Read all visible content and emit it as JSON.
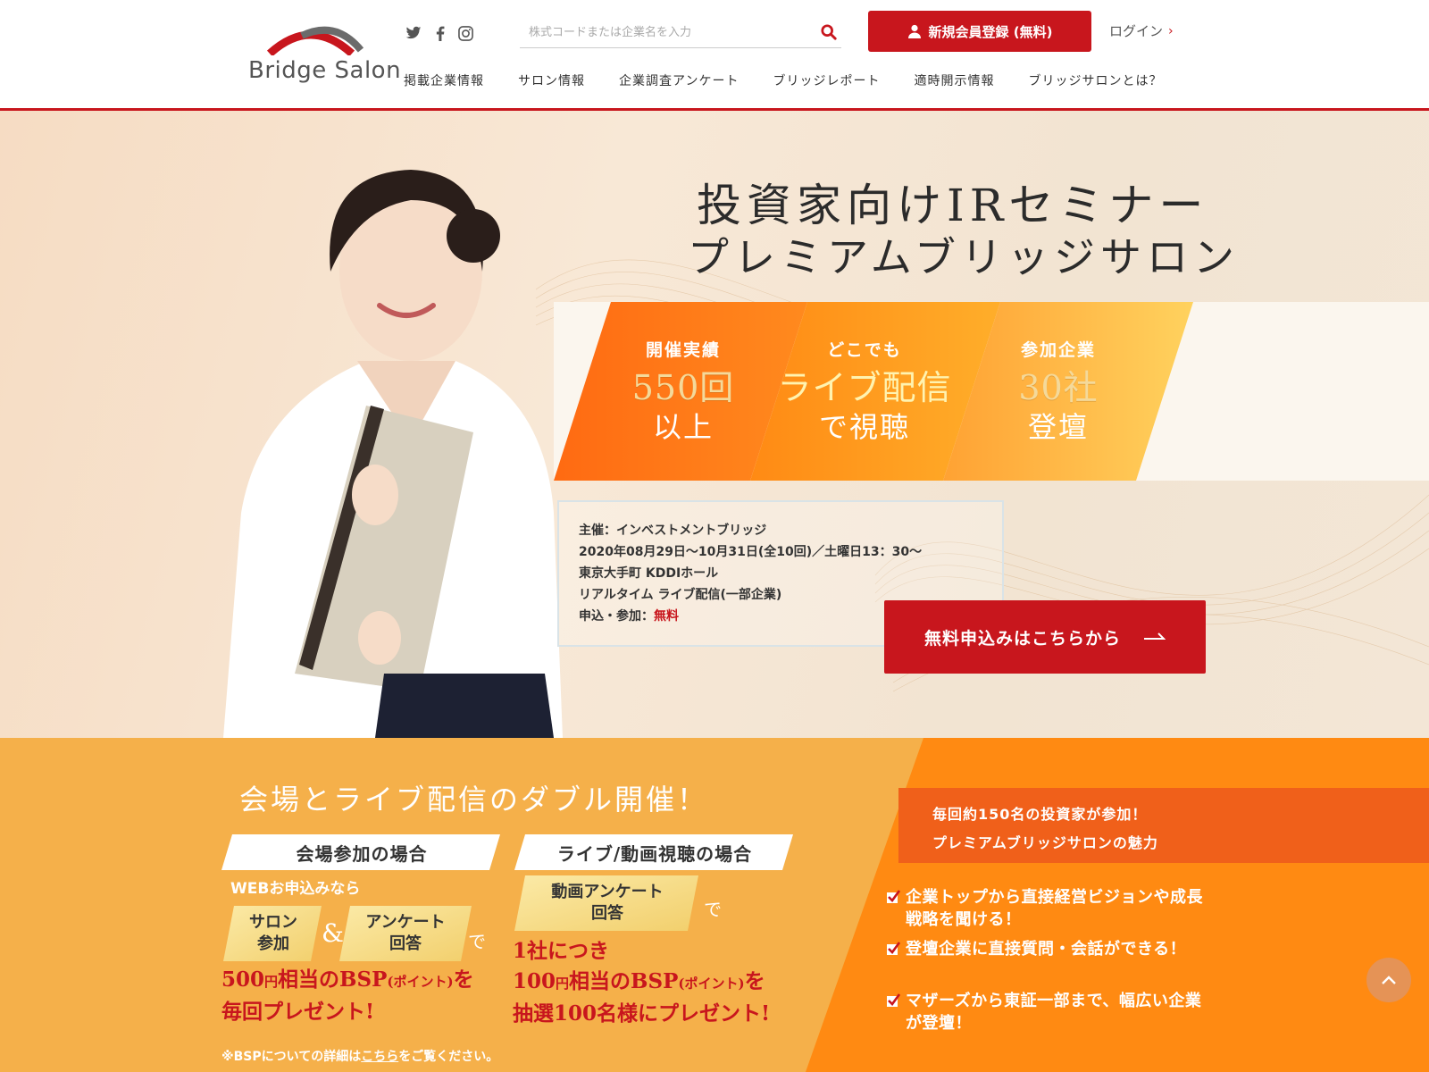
{
  "header": {
    "logo_text": "Bridge Salon",
    "social": [
      {
        "name": "twitter-icon"
      },
      {
        "name": "facebook-icon"
      },
      {
        "name": "instagram-icon"
      }
    ],
    "search": {
      "placeholder": "株式コードまたは企業名を入力"
    },
    "register_label": "新規会員登録 (無料)",
    "login_label": "ログイン",
    "nav": [
      "掲載企業情報",
      "サロン情報",
      "企業調査アンケート",
      "ブリッジレポート",
      "適時開示情報",
      "ブリッジサロンとは？"
    ]
  },
  "hero": {
    "title_line1": "投資家向けIRセミナー",
    "title_line2": "プレミアムブリッジサロン",
    "band": [
      {
        "small": "開催実績",
        "big": "550回",
        "big2": "以上"
      },
      {
        "small": "どこでも",
        "big": "ライブ配信",
        "big2": "で視聴"
      },
      {
        "small": "参加企業",
        "big": "30社",
        "big2": "登壇"
      }
    ],
    "info": {
      "organizer": "主催：インベストメントブリッジ",
      "dates": "2020年08月29日〜10月31日(全10回)／土曜日13：30〜",
      "venue": "東京大手町 KDDIホール",
      "live": "リアルタイム ライブ配信(一部企業)",
      "fee_label": "申込・参加：",
      "fee_value": "無料"
    },
    "cta_label": "無料申込みはこちらから"
  },
  "bottom": {
    "title": "会場とライブ配信のダブル開催！",
    "venue_tab": "会場参加の場合",
    "live_tab": "ライブ/動画視聴の場合",
    "web_note": "WEBお申込みなら",
    "tag_salon_1": "サロン",
    "tag_salon_2": "参加",
    "amp": "&",
    "tag_survey_1": "アンケート",
    "tag_survey_2": "回答",
    "de": "で",
    "tag_video_1": "動画アンケート",
    "tag_video_2": "回答",
    "venue_copy_1a": "500",
    "venue_copy_1b": "円",
    "venue_copy_1c": "相当のBSP",
    "venue_copy_1d": "(ポイント)",
    "venue_copy_1e": "を",
    "venue_copy_2": "毎回プレゼント!",
    "live_copy_1": "1社につき",
    "live_copy_2a": "100",
    "live_copy_2b": "円",
    "live_copy_2c": "相当のBSP",
    "live_copy_2d": "(ポイント)",
    "live_copy_2e": "を",
    "live_copy_3": "抽選100名様にプレゼント!",
    "bsp_note_a": "※BSPについての詳細は",
    "bsp_note_link": "こちら",
    "bsp_note_b": "をご覧ください。",
    "right_head_1": "毎回約150名の投資家が参加！",
    "right_head_2": "プレミアムブリッジサロンの魅力",
    "points": [
      "企業トップから直接経営ビジョンや成長戦略を聞ける！",
      "登壇企業に直接質問・会話ができる！",
      "マザーズから東証一部まで、幅広い企業が登壇！"
    ]
  },
  "colors": {
    "brand_red": "#c8161d",
    "orange": "#f5b04a",
    "deep_orange": "#f0601a"
  }
}
